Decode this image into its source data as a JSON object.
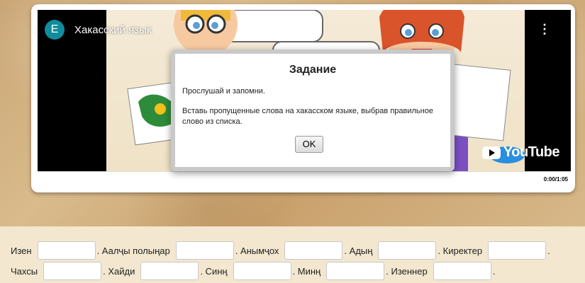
{
  "video": {
    "channel_initial": "E",
    "title": "Хакасский язык",
    "time": "0:00/1:05",
    "platform_logo": "YouTube",
    "menu_icon": "more-vert-icon"
  },
  "dialog": {
    "title": "Задание",
    "line1": "Прослушай и запомни.",
    "line2": "Вставь пропущенные слова на хакасском языке, выбрав правильное слово из списка.",
    "ok_label": "OK"
  },
  "exercise": {
    "row1": [
      "Изен",
      ". Аалҷы полыңар",
      ". Анымҷох",
      ". Адың",
      ". Киректер",
      "."
    ],
    "row2": [
      "Чахсы",
      ". Хайди",
      ". Синң",
      ". Минң",
      ". Изеннер",
      "."
    ]
  }
}
